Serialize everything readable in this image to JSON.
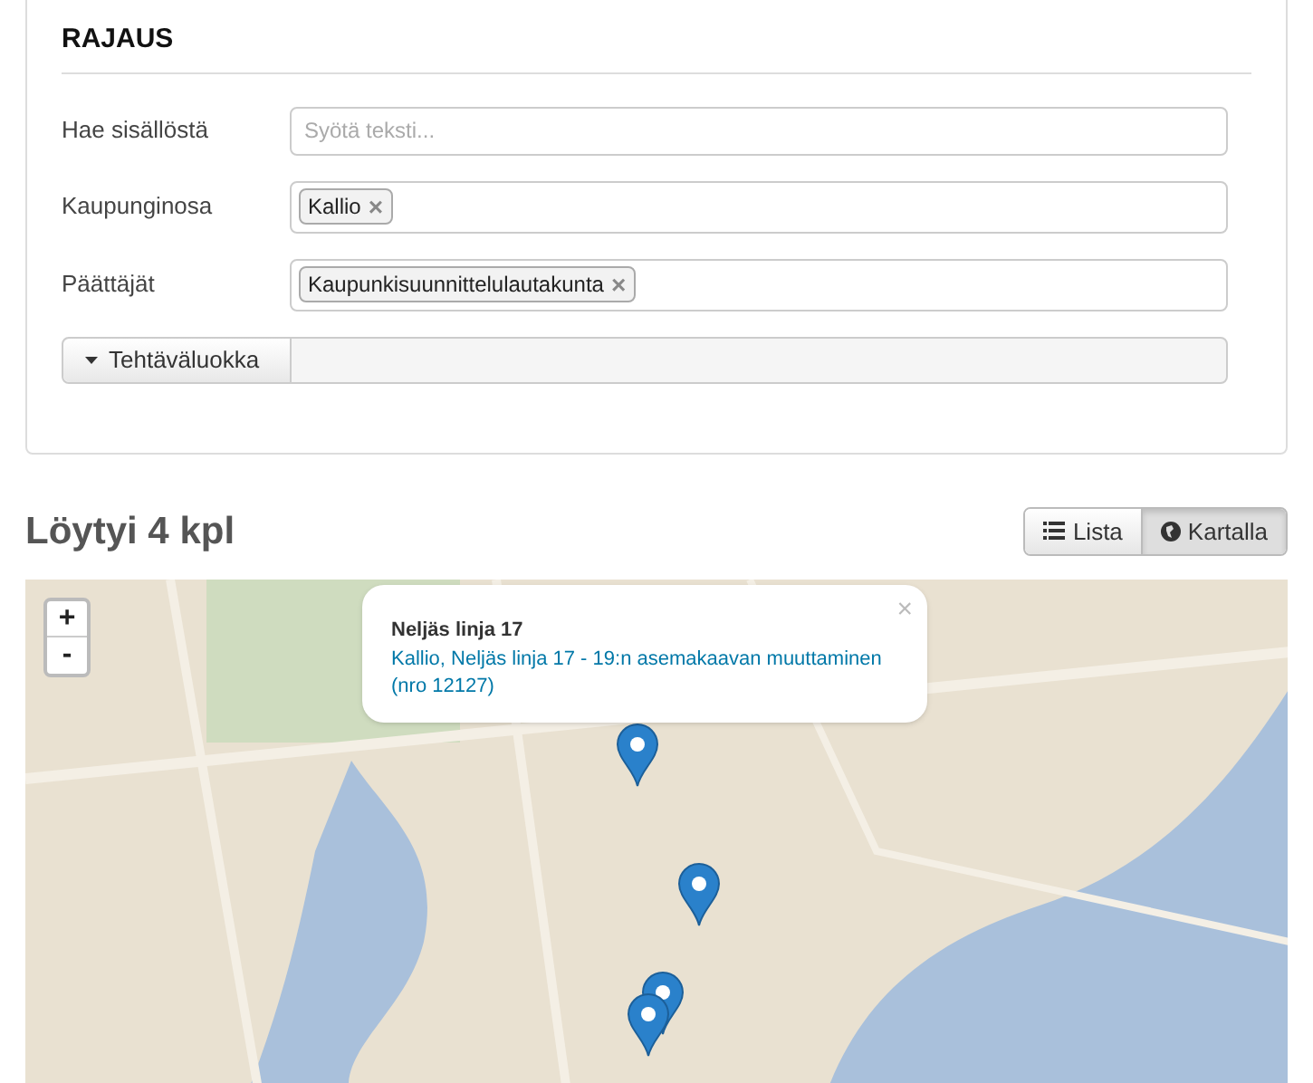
{
  "filter_panel": {
    "title": "RAJAUS",
    "fields": [
      {
        "kind": "text",
        "label": "Hae sisällöstä",
        "placeholder": "Syötä teksti..."
      },
      {
        "kind": "tags",
        "label": "Kaupunginosa",
        "tags": [
          {
            "label": "Kallio",
            "remove": "×"
          }
        ]
      },
      {
        "kind": "tags",
        "label": "Päättäjät",
        "tags": [
          {
            "label": "Kaupunkisuunnittelulautakunta",
            "remove": "×"
          }
        ]
      }
    ],
    "category_button": "Tehtäväluokka"
  },
  "results": {
    "title": "Löytyi 4 kpl",
    "view_toggle": [
      {
        "label": "Lista",
        "selected": false
      },
      {
        "label": "Kartalla",
        "selected": true
      }
    ],
    "map": {
      "zoom_in": "+",
      "zoom_out": "-",
      "popup": {
        "title": "Neljäs linja 17",
        "link": "Kallio, Neljäs linja 17 - 19:n asemakaavan muuttaminen (nro 12127)",
        "close": "×"
      }
    }
  }
}
